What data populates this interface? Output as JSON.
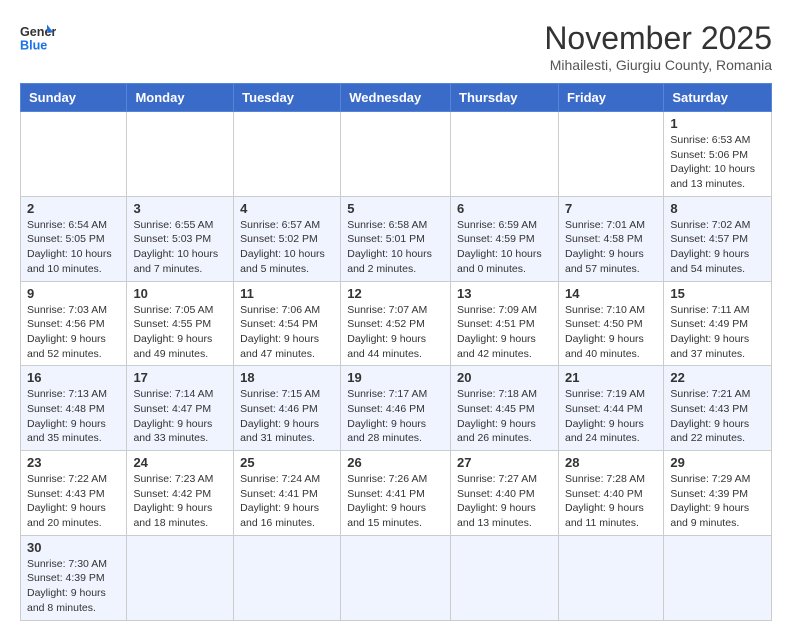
{
  "logo": {
    "line1": "General",
    "line2": "Blue"
  },
  "title": "November 2025",
  "subtitle": "Mihailesti, Giurgiu County, Romania",
  "days_of_week": [
    "Sunday",
    "Monday",
    "Tuesday",
    "Wednesday",
    "Thursday",
    "Friday",
    "Saturday"
  ],
  "weeks": [
    [
      {
        "day": "",
        "info": ""
      },
      {
        "day": "",
        "info": ""
      },
      {
        "day": "",
        "info": ""
      },
      {
        "day": "",
        "info": ""
      },
      {
        "day": "",
        "info": ""
      },
      {
        "day": "",
        "info": ""
      },
      {
        "day": "1",
        "info": "Sunrise: 6:53 AM\nSunset: 5:06 PM\nDaylight: 10 hours and 13 minutes."
      }
    ],
    [
      {
        "day": "2",
        "info": "Sunrise: 6:54 AM\nSunset: 5:05 PM\nDaylight: 10 hours and 10 minutes."
      },
      {
        "day": "3",
        "info": "Sunrise: 6:55 AM\nSunset: 5:03 PM\nDaylight: 10 hours and 7 minutes."
      },
      {
        "day": "4",
        "info": "Sunrise: 6:57 AM\nSunset: 5:02 PM\nDaylight: 10 hours and 5 minutes."
      },
      {
        "day": "5",
        "info": "Sunrise: 6:58 AM\nSunset: 5:01 PM\nDaylight: 10 hours and 2 minutes."
      },
      {
        "day": "6",
        "info": "Sunrise: 6:59 AM\nSunset: 4:59 PM\nDaylight: 10 hours and 0 minutes."
      },
      {
        "day": "7",
        "info": "Sunrise: 7:01 AM\nSunset: 4:58 PM\nDaylight: 9 hours and 57 minutes."
      },
      {
        "day": "8",
        "info": "Sunrise: 7:02 AM\nSunset: 4:57 PM\nDaylight: 9 hours and 54 minutes."
      }
    ],
    [
      {
        "day": "9",
        "info": "Sunrise: 7:03 AM\nSunset: 4:56 PM\nDaylight: 9 hours and 52 minutes."
      },
      {
        "day": "10",
        "info": "Sunrise: 7:05 AM\nSunset: 4:55 PM\nDaylight: 9 hours and 49 minutes."
      },
      {
        "day": "11",
        "info": "Sunrise: 7:06 AM\nSunset: 4:54 PM\nDaylight: 9 hours and 47 minutes."
      },
      {
        "day": "12",
        "info": "Sunrise: 7:07 AM\nSunset: 4:52 PM\nDaylight: 9 hours and 44 minutes."
      },
      {
        "day": "13",
        "info": "Sunrise: 7:09 AM\nSunset: 4:51 PM\nDaylight: 9 hours and 42 minutes."
      },
      {
        "day": "14",
        "info": "Sunrise: 7:10 AM\nSunset: 4:50 PM\nDaylight: 9 hours and 40 minutes."
      },
      {
        "day": "15",
        "info": "Sunrise: 7:11 AM\nSunset: 4:49 PM\nDaylight: 9 hours and 37 minutes."
      }
    ],
    [
      {
        "day": "16",
        "info": "Sunrise: 7:13 AM\nSunset: 4:48 PM\nDaylight: 9 hours and 35 minutes."
      },
      {
        "day": "17",
        "info": "Sunrise: 7:14 AM\nSunset: 4:47 PM\nDaylight: 9 hours and 33 minutes."
      },
      {
        "day": "18",
        "info": "Sunrise: 7:15 AM\nSunset: 4:46 PM\nDaylight: 9 hours and 31 minutes."
      },
      {
        "day": "19",
        "info": "Sunrise: 7:17 AM\nSunset: 4:46 PM\nDaylight: 9 hours and 28 minutes."
      },
      {
        "day": "20",
        "info": "Sunrise: 7:18 AM\nSunset: 4:45 PM\nDaylight: 9 hours and 26 minutes."
      },
      {
        "day": "21",
        "info": "Sunrise: 7:19 AM\nSunset: 4:44 PM\nDaylight: 9 hours and 24 minutes."
      },
      {
        "day": "22",
        "info": "Sunrise: 7:21 AM\nSunset: 4:43 PM\nDaylight: 9 hours and 22 minutes."
      }
    ],
    [
      {
        "day": "23",
        "info": "Sunrise: 7:22 AM\nSunset: 4:43 PM\nDaylight: 9 hours and 20 minutes."
      },
      {
        "day": "24",
        "info": "Sunrise: 7:23 AM\nSunset: 4:42 PM\nDaylight: 9 hours and 18 minutes."
      },
      {
        "day": "25",
        "info": "Sunrise: 7:24 AM\nSunset: 4:41 PM\nDaylight: 9 hours and 16 minutes."
      },
      {
        "day": "26",
        "info": "Sunrise: 7:26 AM\nSunset: 4:41 PM\nDaylight: 9 hours and 15 minutes."
      },
      {
        "day": "27",
        "info": "Sunrise: 7:27 AM\nSunset: 4:40 PM\nDaylight: 9 hours and 13 minutes."
      },
      {
        "day": "28",
        "info": "Sunrise: 7:28 AM\nSunset: 4:40 PM\nDaylight: 9 hours and 11 minutes."
      },
      {
        "day": "29",
        "info": "Sunrise: 7:29 AM\nSunset: 4:39 PM\nDaylight: 9 hours and 9 minutes."
      }
    ],
    [
      {
        "day": "30",
        "info": "Sunrise: 7:30 AM\nSunset: 4:39 PM\nDaylight: 9 hours and 8 minutes."
      },
      {
        "day": "",
        "info": ""
      },
      {
        "day": "",
        "info": ""
      },
      {
        "day": "",
        "info": ""
      },
      {
        "day": "",
        "info": ""
      },
      {
        "day": "",
        "info": ""
      },
      {
        "day": "",
        "info": ""
      }
    ]
  ]
}
